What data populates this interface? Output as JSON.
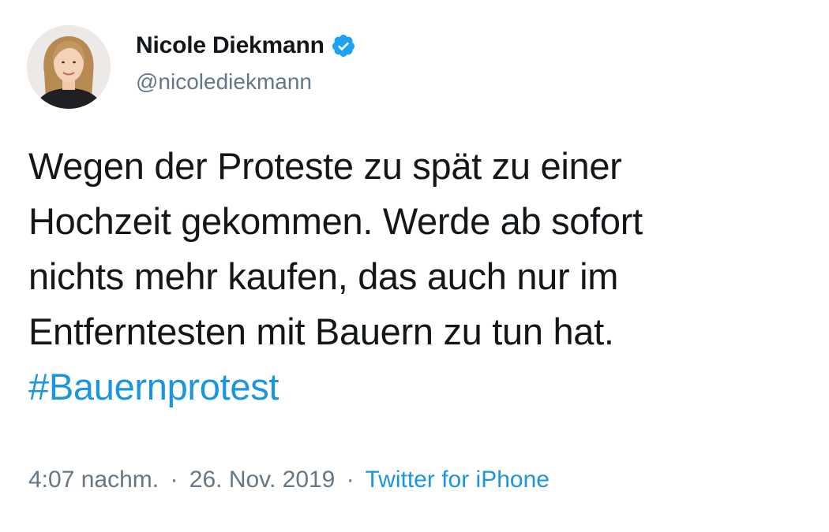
{
  "author": {
    "display_name": "Nicole Diekmann",
    "handle": "@nicolediekmann",
    "verified_icon": "verified-badge-icon"
  },
  "tweet": {
    "lines": [
      "Wegen der Proteste zu spät zu einer",
      "Hochzeit gekommen. Werde ab sofort",
      "nichts mehr kaufen, das auch nur im",
      "Entferntesten mit Bauern zu tun hat."
    ],
    "hashtag": "#Bauernprotest"
  },
  "meta": {
    "time": "4:07 nachm.",
    "separator": "·",
    "date": "26. Nov. 2019",
    "source": "Twitter for iPhone"
  },
  "colors": {
    "link": "#1b95e0",
    "secondary_text": "#657786",
    "primary_text": "#14171a",
    "verified": "#1da1f2"
  }
}
